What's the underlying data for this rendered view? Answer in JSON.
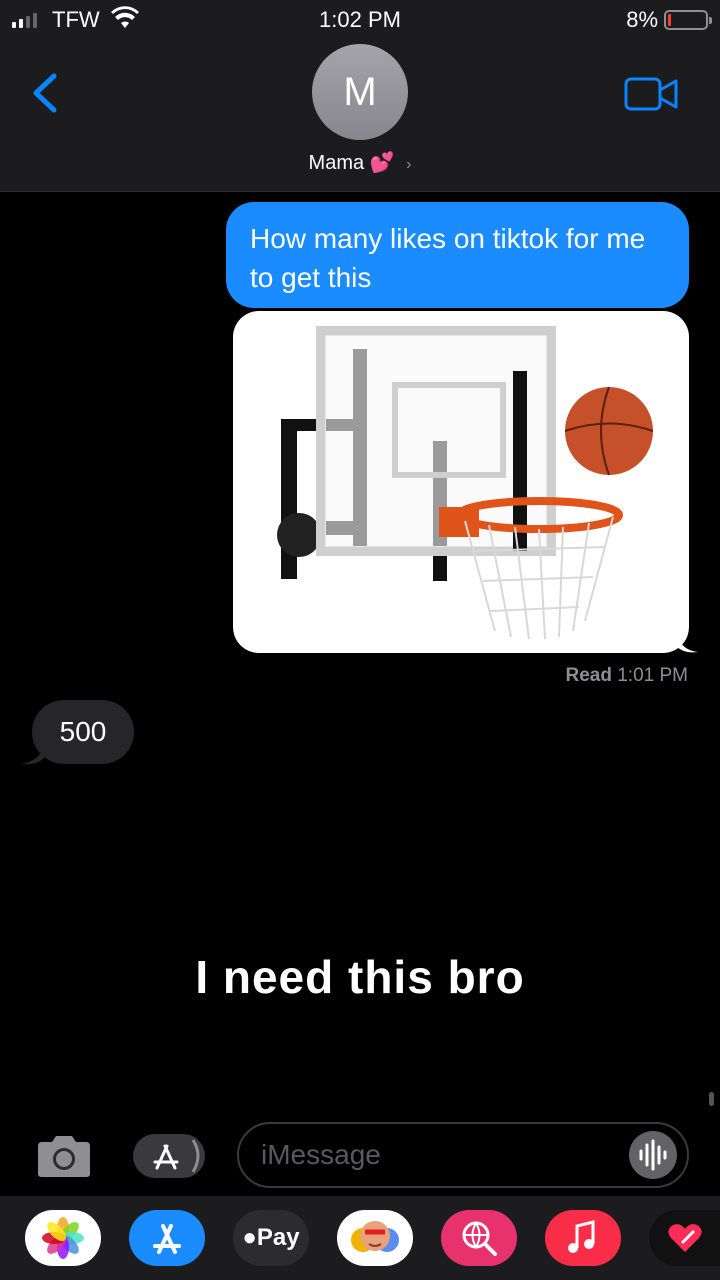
{
  "status_bar": {
    "carrier": "TFW",
    "time": "1:02 PM",
    "battery_percent": "8%",
    "battery_level": 0.08
  },
  "header": {
    "avatar_initial": "M",
    "contact_name": "Mama",
    "contact_emoji": "💕",
    "chevron": "›",
    "back_icon": "chevron-left-icon",
    "video_icon": "video-camera-icon"
  },
  "messages": {
    "outgoing_text": "How many likes on tiktok for me to get this",
    "image_description_icon": "basketball-hoop-image",
    "read_label": "Read",
    "read_time": "1:01 PM",
    "incoming_text": "500"
  },
  "caption": "I need this bro",
  "input_bar": {
    "placeholder": "iMessage"
  },
  "app_drawer": {
    "apps": [
      {
        "name": "photos-app-icon"
      },
      {
        "name": "appstore-app-icon"
      },
      {
        "name": "applepay-app-icon",
        "label": "Pay"
      },
      {
        "name": "memoji-app-icon"
      },
      {
        "name": "web-search-app-icon"
      },
      {
        "name": "music-app-icon"
      },
      {
        "name": "digital-touch-app-icon"
      }
    ]
  },
  "colors": {
    "bubble_out": "#1a8cff",
    "bubble_in": "#262628",
    "accent": "#0a84ff",
    "background": "#000000"
  }
}
